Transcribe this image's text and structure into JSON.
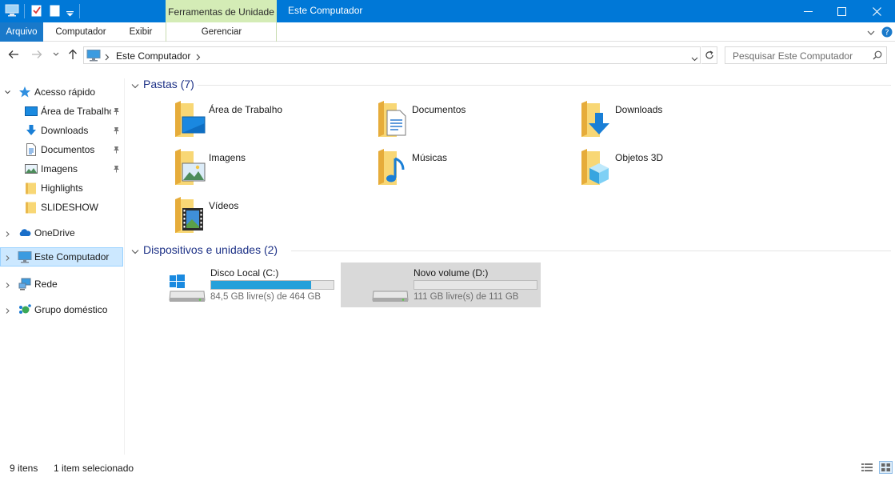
{
  "window": {
    "title": "Este Computador",
    "contextual_tab": "Ferramentas de Unidade",
    "accent": "#0078d7"
  },
  "ribbon": {
    "tabs": [
      {
        "label": "Arquivo"
      },
      {
        "label": "Computador"
      },
      {
        "label": "Exibir"
      },
      {
        "label": "Gerenciar"
      }
    ]
  },
  "address": {
    "path": "Este Computador",
    "search_placeholder": "Pesquisar Este Computador"
  },
  "sidebar": {
    "quick_access": "Acesso rápido",
    "pinned": [
      {
        "label": "Área de Trabalho",
        "icon": "desktop-icon",
        "pinned": true
      },
      {
        "label": "Downloads",
        "icon": "download-arrow-icon",
        "pinned": true
      },
      {
        "label": "Documentos",
        "icon": "document-icon",
        "pinned": true
      },
      {
        "label": "Imagens",
        "icon": "pictures-icon",
        "pinned": true
      },
      {
        "label": "Highlights",
        "icon": "folder-icon",
        "pinned": false
      },
      {
        "label": "SLIDESHOW",
        "icon": "folder-icon",
        "pinned": false
      }
    ],
    "roots": [
      {
        "label": "OneDrive",
        "icon": "onedrive-icon"
      },
      {
        "label": "Este Computador",
        "icon": "computer-icon",
        "selected": true
      },
      {
        "label": "Rede",
        "icon": "network-icon"
      },
      {
        "label": "Grupo doméstico",
        "icon": "homegroup-icon"
      }
    ]
  },
  "main": {
    "folders_header": "Pastas (7)",
    "folders": [
      {
        "label": "Área de Trabalho",
        "icon": "desktop-folder-icon"
      },
      {
        "label": "Documentos",
        "icon": "documents-folder-icon"
      },
      {
        "label": "Downloads",
        "icon": "downloads-folder-icon"
      },
      {
        "label": "Imagens",
        "icon": "pictures-folder-icon"
      },
      {
        "label": "Músicas",
        "icon": "music-folder-icon"
      },
      {
        "label": "Objetos 3D",
        "icon": "3d-objects-folder-icon"
      },
      {
        "label": "Vídeos",
        "icon": "videos-folder-icon"
      }
    ],
    "devices_header": "Dispositivos e unidades (2)",
    "drives": [
      {
        "name": "Disco Local (C:)",
        "free": "84,5 GB livre(s) de 464 GB",
        "used_fraction": 0.818,
        "selected": false
      },
      {
        "name": "Novo volume (D:)",
        "free": "111 GB livre(s) de 111 GB",
        "used_fraction": 0.0,
        "selected": true
      }
    ]
  },
  "status": {
    "count": "9 itens",
    "selection": "1 item selecionado"
  }
}
